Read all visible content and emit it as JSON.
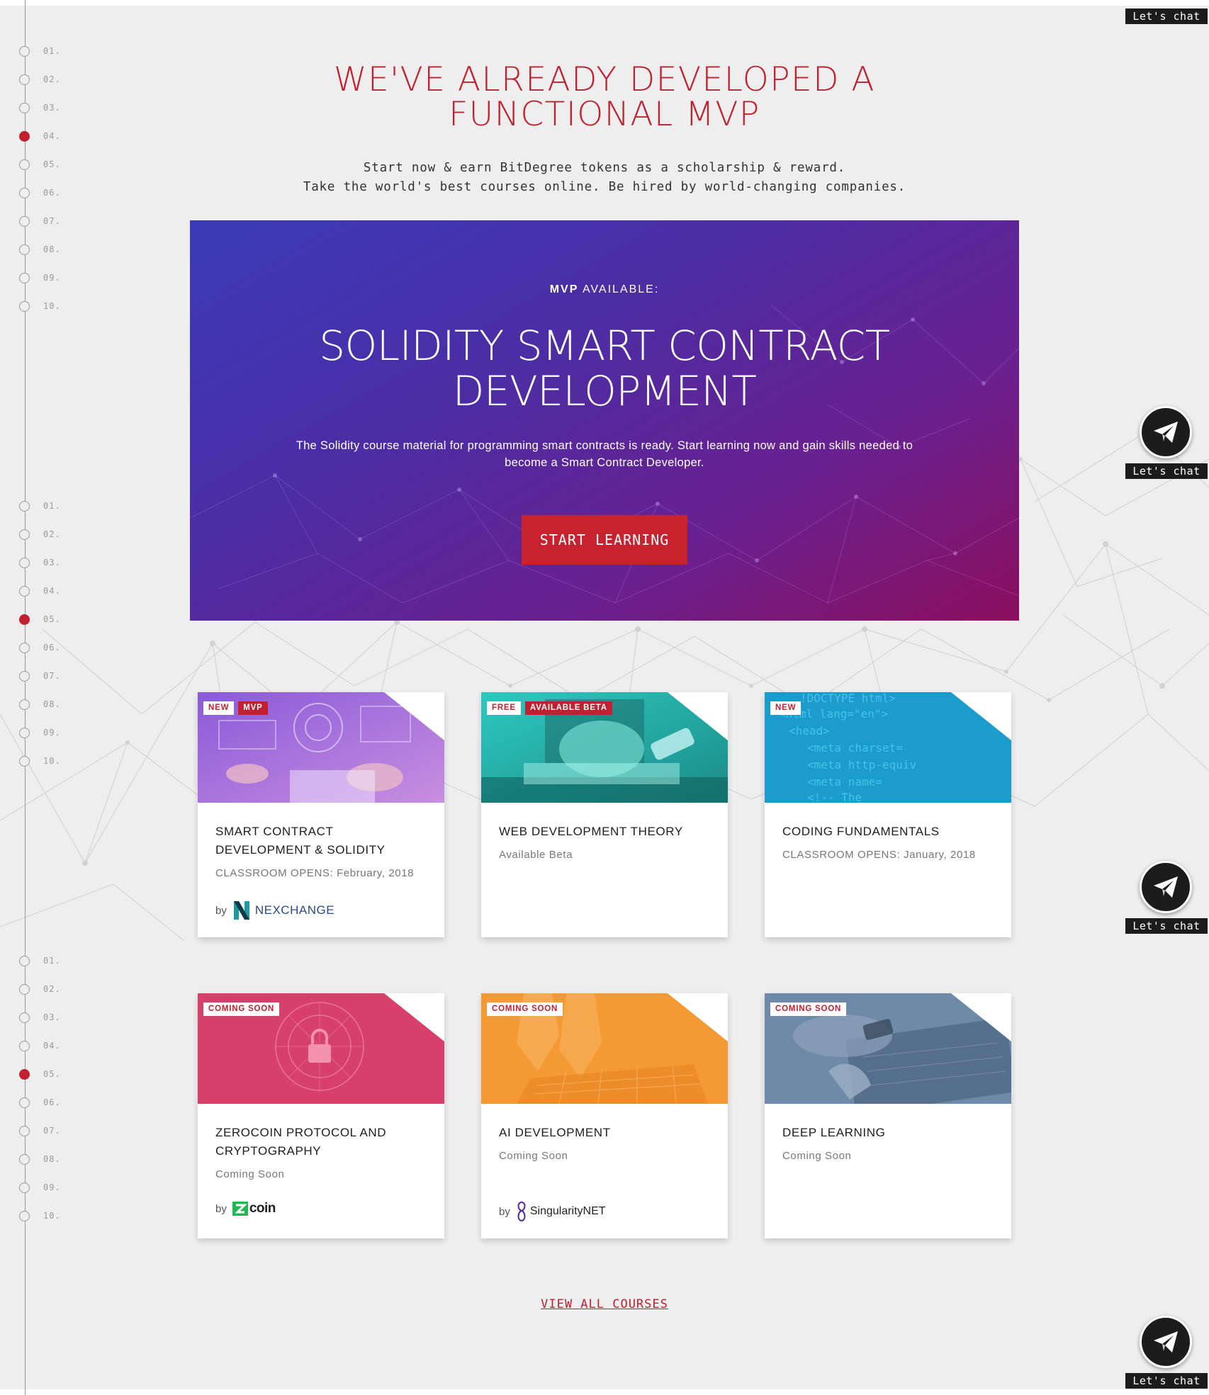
{
  "section_nav": {
    "groups": [
      {
        "items": [
          "01.",
          "02.",
          "03.",
          "04.",
          "05.",
          "06.",
          "07.",
          "08.",
          "09.",
          "10."
        ],
        "active_index": 3
      },
      {
        "items": [
          "01.",
          "02.",
          "03.",
          "04.",
          "05.",
          "06.",
          "07.",
          "08.",
          "09.",
          "10."
        ],
        "active_index": 4
      },
      {
        "items": [
          "01.",
          "02.",
          "03.",
          "04.",
          "05.",
          "06.",
          "07.",
          "08.",
          "09.",
          "10."
        ],
        "active_index": 4
      }
    ]
  },
  "header": {
    "title": "WE'VE ALREADY DEVELOPED A FUNCTIONAL MVP",
    "subtitle_line1": "Start now & earn BitDegree tokens as a scholarship & reward.",
    "subtitle_line2": "Take the world's best courses online. Be hired by world-changing companies."
  },
  "hero": {
    "eyebrow_bold": "MVP",
    "eyebrow_rest": " AVAILABLE:",
    "title": "SOLIDITY SMART CONTRACT DEVELOPMENT",
    "description": "The Solidity course material for programming smart contracts is ready. Start learning now and gain skills needed to become a Smart Contract Developer.",
    "button_label": "START LEARNING"
  },
  "courses": [
    {
      "title": "SMART CONTRACT DEVELOPMENT & SOLIDITY",
      "subtitle": "CLASSROOM OPENS: February, 2018",
      "badges": [
        {
          "text": "NEW",
          "style": "white"
        },
        {
          "text": "MVP",
          "style": "red"
        }
      ],
      "by_label": "by",
      "partner": "NEXCHANGE",
      "image": "purple"
    },
    {
      "title": "WEB DEVELOPMENT THEORY",
      "subtitle": "Available Beta",
      "badges": [
        {
          "text": "FREE",
          "style": "white"
        },
        {
          "text": "AVAILABLE BETA",
          "style": "red"
        }
      ],
      "image": "teal"
    },
    {
      "title": "CODING FUNDAMENTALS",
      "subtitle": "CLASSROOM OPENS: January, 2018",
      "badges": [
        {
          "text": "NEW",
          "style": "white"
        }
      ],
      "image": "blue"
    },
    {
      "title": "ZEROCOIN PROTOCOL AND CRYPTOGRAPHY",
      "subtitle": "Coming Soon",
      "badges": [
        {
          "text": "COMING SOON",
          "style": "white"
        }
      ],
      "by_label": "by",
      "partner": "coin",
      "image": "pink"
    },
    {
      "title": "AI DEVELOPMENT",
      "subtitle": "Coming Soon",
      "badges": [
        {
          "text": "COMING SOON",
          "style": "white"
        }
      ],
      "by_label": "by",
      "partner": "SingularityNET",
      "image": "orange"
    },
    {
      "title": "DEEP LEARNING",
      "subtitle": "Coming Soon",
      "badges": [
        {
          "text": "COMING SOON",
          "style": "white"
        }
      ],
      "image": "slate"
    }
  ],
  "view_all_label": "VIEW ALL COURSES",
  "chat": {
    "label": "Let's chat",
    "icon": "paper-plane-icon"
  },
  "colors": {
    "accent": "#c0202f",
    "hero_start": "#3b3bb8",
    "hero_end": "#8b0f5e",
    "dark": "#1c1c1c"
  }
}
